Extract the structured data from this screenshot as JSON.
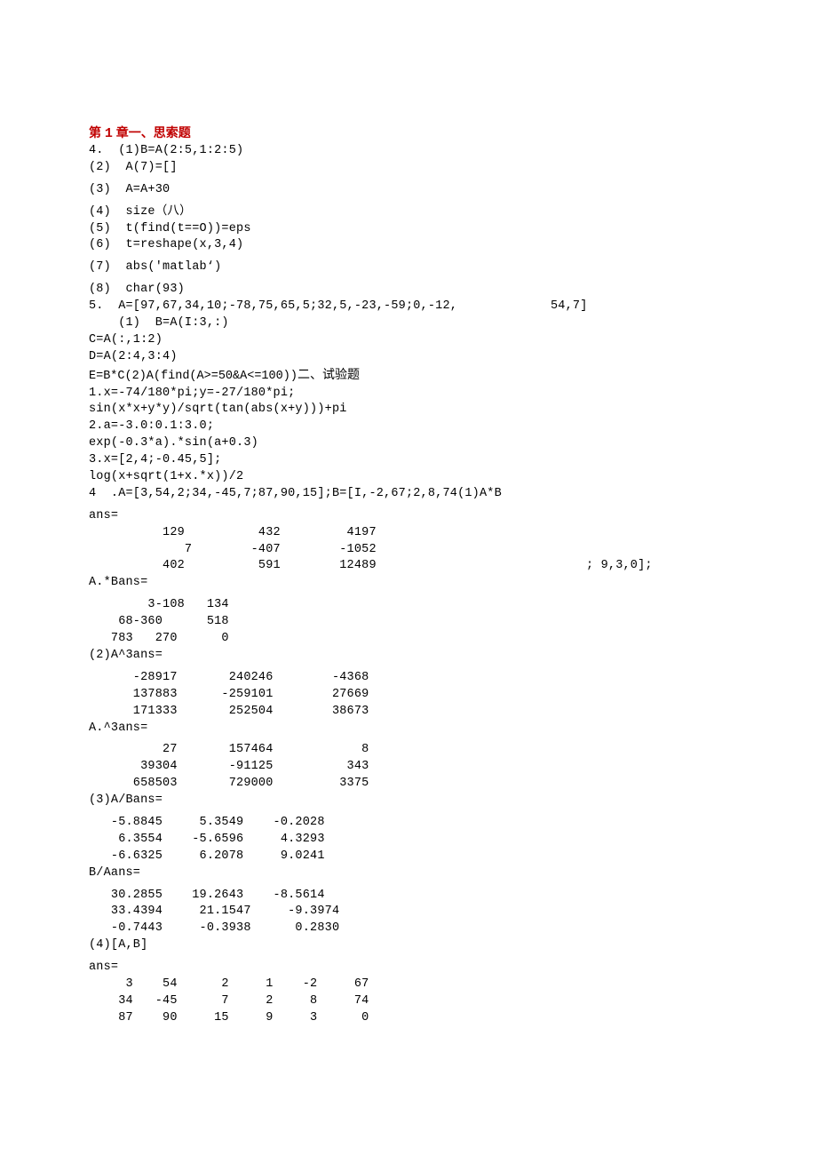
{
  "title": {
    "p1": "第 ",
    "n": "1",
    "p2": " 章一、思索题"
  },
  "l01": "4.  (1)B=A(2:5,1:2:5)",
  "l02": "(2)  A(7)=[]",
  "l03": "(3)  A=A+30",
  "l04": "(4)  size（八）",
  "l05": "(5)  t(find(t==O))=eps",
  "l06": "(6)  t=reshape(x,3,4)",
  "l07": "(7)  abs('matlab‘)",
  "l08": "(8)  char(93)",
  "l09a": "5.  A=[97,67,34,10;-78,75,65,5;32,5,-23,-59;0,-12,",
  "l09b": "54,7]",
  "l10": "    (1)  B=A(I:3,:)",
  "l11": "C=A(:,1:2)",
  "l12": "D=A(2:4,3:4)",
  "l13a": "E=B*C(2)A(find(A>=50&A<=100))",
  "l13b": "二、试验题",
  "l14": "1.x=-74/180*pi;y=-27/180*pi;",
  "l15": "sin(x*x+y*y)/sqrt(tan(abs(x+y)))+pi",
  "l16": "2.a=-3.0:0.1:3.0;",
  "l17": "exp(-0.3*a).*sin(a+0.3)",
  "l18": "3.x=[2,4;-0.45,5];",
  "l19": "log(x+sqrt(1+x.*x))/2",
  "l20": "4  .A=[3,54,2;34,-45,7;87,90,15];B=[I,-2,67;2,8,74(1)A*B",
  "l21": "ans=",
  "l22": "          129          432         4197",
  "l23a": "             7        -407        -1052",
  "l23b": "",
  "l24a": "          402          591        12489",
  "l24b": "; 9,3,0];",
  "l25": "A.*Bans=",
  "l26": "        3-108   134",
  "l27": "    68-360      518",
  "l28": "   783   270      0",
  "l29": "(2)A^3ans=",
  "l30": "      -28917       240246        -4368",
  "l31": "      137883      -259101        27669",
  "l32": "      171333       252504        38673",
  "l33": "A.^3ans=",
  "l34": "          27       157464            8",
  "l35": "       39304       -91125          343",
  "l36": "      658503       729000         3375",
  "l37": "(3)A/Bans=",
  "l38": "   -5.8845     5.3549    -0.2028",
  "l39": "    6.3554    -5.6596     4.3293",
  "l40": "   -6.6325     6.2078     9.0241",
  "l41": "B/Aans=",
  "l42": "   30.2855    19.2643    -8.5614",
  "l43": "   33.4394     21.1547     -9.3974",
  "l44": "   -0.7443     -0.3938      0.2830",
  "l45": "(4)[A,B]",
  "l46": "ans=",
  "l47": "     3    54      2     1    -2     67",
  "l48": "    34   -45      7     2     8     74",
  "l49": "    87    90     15     9     3      0"
}
